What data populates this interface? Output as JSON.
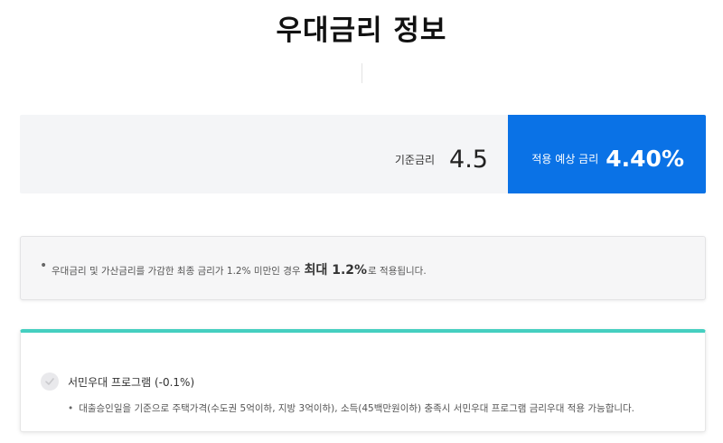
{
  "page": {
    "title": "우대금리 정보"
  },
  "rates": {
    "base_label": "기준금리",
    "base_value": "4.5",
    "expected_label": "적용 예상 금리",
    "expected_value": "4.40%",
    "accent_color": "#0a72e6"
  },
  "notice": {
    "bullet": "•",
    "text_before": "우대금리 및 가산금리를 가감한 최종 금리가 1.2% 미만인 경우",
    "emphasis": "최대 1.2%",
    "text_after": "로 적용됩니다."
  },
  "program": {
    "accent_color": "#45cfc0",
    "check_icon": "check-icon",
    "title": "서민우대 프로그램 (-0.1%)",
    "bullet": "•",
    "description": "대출승인일을 기준으로 주택가격(수도권 5억이하, 지방 3억이하), 소득(45백만원이하) 충족시 서민우대 프로그램 금리우대 적용 가능합니다."
  }
}
